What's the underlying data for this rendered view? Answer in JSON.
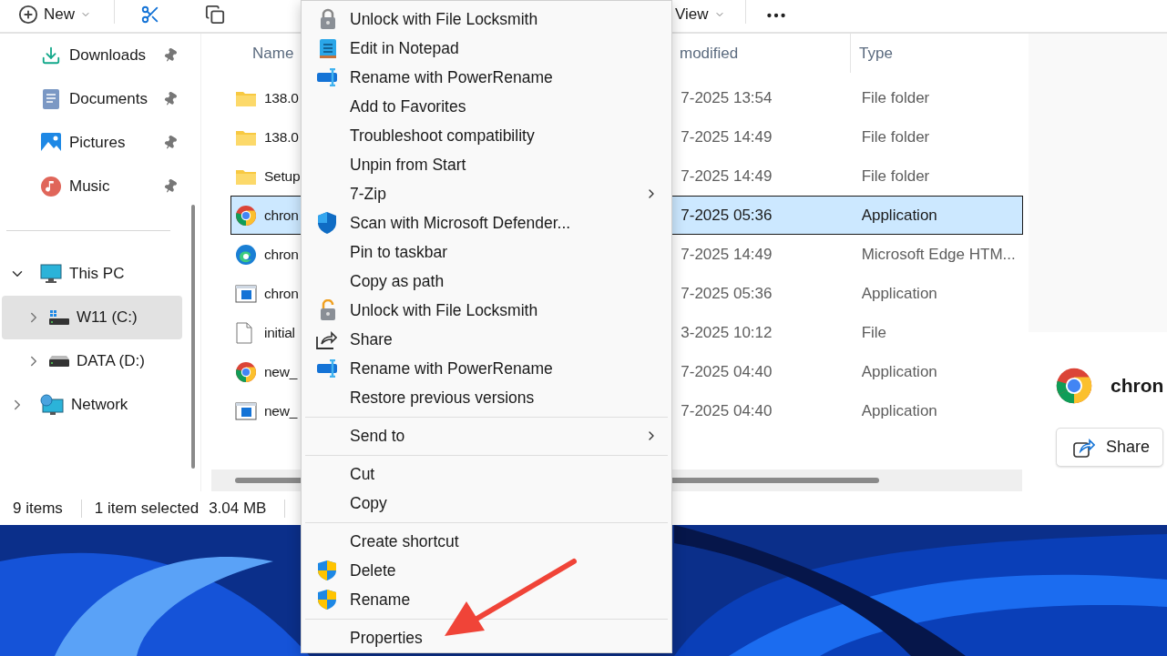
{
  "toolbar": {
    "new_label": "New",
    "view_label": "View"
  },
  "sidebar": {
    "quick_access": [
      {
        "label": "Downloads",
        "kind": "download",
        "pinned": true
      },
      {
        "label": "Documents",
        "kind": "documents",
        "pinned": true
      },
      {
        "label": "Pictures",
        "kind": "pictures",
        "pinned": true
      },
      {
        "label": "Music",
        "kind": "music",
        "pinned": true
      }
    ],
    "tree": [
      {
        "label": "This PC",
        "kind": "pc",
        "expanded": true,
        "selected": false,
        "children": [
          {
            "label": "W11 (C:)",
            "kind": "system-drive",
            "expanded": false,
            "selected": true
          },
          {
            "label": "DATA (D:)",
            "kind": "drive",
            "expanded": false,
            "selected": false
          }
        ]
      },
      {
        "label": "Network",
        "kind": "network",
        "expanded": false,
        "selected": false
      }
    ]
  },
  "file_list": {
    "columns": [
      "Name",
      "modified",
      "Type"
    ],
    "rows": [
      {
        "name": "138.0",
        "kind": "folder",
        "modified": "7-2025 13:54",
        "type": "File folder",
        "selected": false
      },
      {
        "name": "138.0",
        "kind": "folder",
        "modified": "7-2025 14:49",
        "type": "File folder",
        "selected": false
      },
      {
        "name": "Setup",
        "kind": "folder",
        "modified": "7-2025 14:49",
        "type": "File folder",
        "selected": false
      },
      {
        "name": "chron",
        "kind": "chrome",
        "modified": "7-2025 05:36",
        "type": "Application",
        "selected": true
      },
      {
        "name": "chron",
        "kind": "edge",
        "modified": "7-2025 14:49",
        "type": "Microsoft Edge HTM...",
        "selected": false
      },
      {
        "name": "chron",
        "kind": "app",
        "modified": "7-2025 05:36",
        "type": "Application",
        "selected": false
      },
      {
        "name": "initial",
        "kind": "file",
        "modified": "3-2025 10:12",
        "type": "File",
        "selected": false
      },
      {
        "name": "new_",
        "kind": "chrome",
        "modified": "7-2025 04:40",
        "type": "Application",
        "selected": false
      },
      {
        "name": "new_",
        "kind": "app",
        "modified": "7-2025 04:40",
        "type": "Application",
        "selected": false
      }
    ]
  },
  "context_menu": [
    {
      "kind": "lock",
      "label": "Unlock with File Locksmith"
    },
    {
      "kind": "notepad",
      "label": "Edit in Notepad"
    },
    {
      "kind": "rename-tool",
      "label": "Rename with PowerRename"
    },
    {
      "kind": "plain",
      "label": "Add to Favorites"
    },
    {
      "kind": "plain",
      "label": "Troubleshoot compatibility"
    },
    {
      "kind": "plain",
      "label": "Unpin from Start"
    },
    {
      "kind": "plain",
      "label": "7-Zip",
      "submenu": true
    },
    {
      "kind": "defender",
      "label": "Scan with Microsoft Defender..."
    },
    {
      "kind": "plain",
      "label": "Pin to taskbar"
    },
    {
      "kind": "plain",
      "label": "Copy as path"
    },
    {
      "kind": "unlock",
      "label": "Unlock with File Locksmith"
    },
    {
      "kind": "share",
      "label": "Share"
    },
    {
      "kind": "rename-tool",
      "label": "Rename with PowerRename"
    },
    {
      "kind": "plain",
      "label": "Restore previous versions"
    },
    {
      "kind": "separator"
    },
    {
      "kind": "plain",
      "label": "Send to",
      "submenu": true
    },
    {
      "kind": "separator"
    },
    {
      "kind": "plain",
      "label": "Cut"
    },
    {
      "kind": "plain",
      "label": "Copy"
    },
    {
      "kind": "separator"
    },
    {
      "kind": "plain",
      "label": "Create shortcut"
    },
    {
      "kind": "uac",
      "label": "Delete"
    },
    {
      "kind": "uac",
      "label": "Rename"
    },
    {
      "kind": "separator"
    },
    {
      "kind": "plain",
      "label": "Properties"
    }
  ],
  "preview": {
    "name": "chron",
    "share_label": "Share"
  },
  "status_bar": {
    "count": "9 items",
    "selection": "1 item selected",
    "size": "3.04 MB"
  }
}
